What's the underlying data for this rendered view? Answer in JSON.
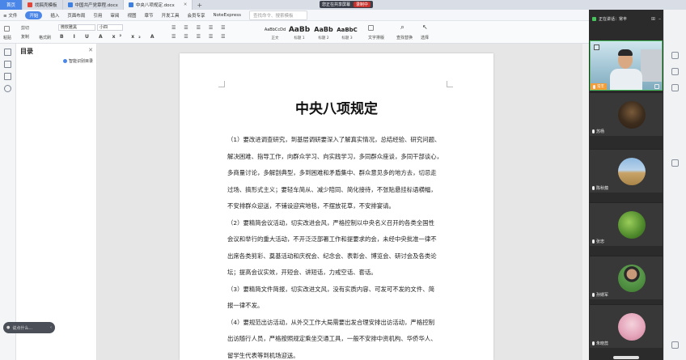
{
  "tabs": {
    "home": "首页",
    "t1": "找稿壳模板",
    "t2": "中国共产党章程.docx",
    "t3": "中央八项规定.docx"
  },
  "share_badge": {
    "sharing": "您正在共享屏幕",
    "recording": "录制中"
  },
  "menu": {
    "file": "≡ 文件",
    "start": "开始",
    "insert": "插入",
    "layout": "页面布局",
    "reference": "引用",
    "review": "审阅",
    "view": "视图",
    "section": "章节",
    "dev": "开发工具",
    "vip": "会员专享",
    "note": "NoteExpress",
    "search_placeholder": "查找命令、搜索模板"
  },
  "ribbon": {
    "paste": "粘贴",
    "cut": "剪切",
    "copy": "复制",
    "format_painter": "格式刷",
    "font_name": "微软雅黑",
    "font_size": "小四",
    "styles": [
      {
        "preview": "AaBbCcDd",
        "label": "正文"
      },
      {
        "preview": "AaBb",
        "label": "标题 1"
      },
      {
        "preview": "AaBb",
        "label": "标题 2"
      },
      {
        "preview": "AaBbC",
        "label": "标题 3"
      }
    ],
    "text_layout": "文字排版",
    "find_replace": "查找替换",
    "select": "选择"
  },
  "toc": {
    "title": "目录",
    "smart": "智能识别目录",
    "input_placeholder": "说点什么..."
  },
  "document": {
    "title": "中央八项规定",
    "lines": [
      "（1）要改进调查研究，到基层调研要深入了解真实情况，总结经验、研究问题、",
      "解决困难、指导工作，向群众学习、向实践学习，多同群众座谈，多同干部谈心，",
      "多商量讨论，多解剖典型，多到困难和矛盾集中、群众意见多的地方去，切忌走",
      "过场、搞形式主义；要轻车简从、减少陪同、简化接待，不张贴悬挂标语横幅，",
      "不安排群众迎送，不铺设迎宾地毯，不摆放花草，不安排宴请。",
      "（2）要精简会议活动，切实改进会风，严格控制以中央名义召开的各类全国性",
      "会议和举行的重大活动，不开泛泛部署工作和提要求的会，未经中央批准一律不",
      "出席各类剪彩、奠基活动和庆祝会、纪念会、表彰会、博览会、研讨会及各类论",
      "坛；提高会议实效，开短会、讲短话，力戒空话、套话。",
      "（3）要精简文件简报，切实改进文风，没有实质内容、可发可不发的文件、简",
      "报一律不发。",
      "（4）要规范出访活动，从外交工作大局需要出发合理安排出访活动，严格控制",
      "出访随行人员，严格按照规定乘坐交通工具，一般不安排中资机构、华侨华人、",
      "留学生代表等到机场迎送。"
    ]
  },
  "meeting": {
    "header": "正在讲话：常丰",
    "speaker_name": "常丰",
    "participants": [
      "苏杨",
      "陈秋蕴",
      "张忠",
      "孙婿军",
      "朱晓蕊"
    ]
  },
  "colors": {
    "accent": "#4a86e8",
    "speaking_border": "#46c35c",
    "speaker_label": "#f29d38",
    "panel_bg": "#2b2b2b",
    "recording": "#c9302c"
  },
  "icons": [
    "close-icon",
    "mic-icon",
    "pin-icon",
    "minimize-icon",
    "expand-icon",
    "search-icon",
    "outline-icon",
    "bookmark-icon"
  ]
}
